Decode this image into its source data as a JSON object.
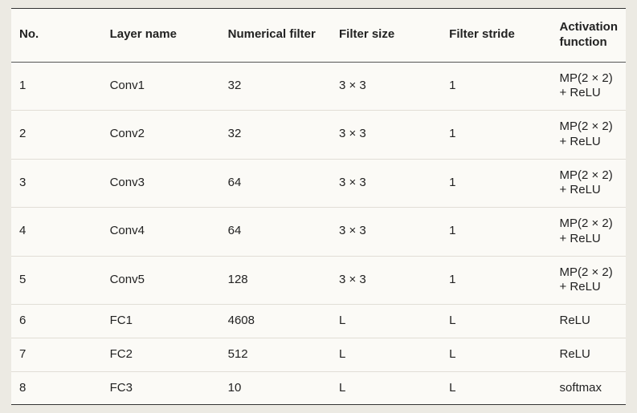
{
  "chart_data": {
    "type": "table",
    "headers": [
      "No.",
      "Layer name",
      "Numerical filter",
      "Filter size",
      "Filter stride",
      "Activation function"
    ],
    "rows": [
      {
        "no": "1",
        "layer": "Conv1",
        "numf": "32",
        "fsize": "3 × 3",
        "stride": "1",
        "act": "MP(2 × 2) + ReLU"
      },
      {
        "no": "2",
        "layer": "Conv2",
        "numf": "32",
        "fsize": "3 × 3",
        "stride": "1",
        "act": "MP(2 × 2) + ReLU"
      },
      {
        "no": "3",
        "layer": "Conv3",
        "numf": "64",
        "fsize": "3 × 3",
        "stride": "1",
        "act": "MP(2 × 2) + ReLU"
      },
      {
        "no": "4",
        "layer": "Conv4",
        "numf": "64",
        "fsize": "3 × 3",
        "stride": "1",
        "act": "MP(2 × 2) + ReLU"
      },
      {
        "no": "5",
        "layer": "Conv5",
        "numf": "128",
        "fsize": "3 × 3",
        "stride": "1",
        "act": "MP(2 × 2) + ReLU"
      },
      {
        "no": "6",
        "layer": "FC1",
        "numf": "4608",
        "fsize": "L",
        "stride": "L",
        "act": "ReLU"
      },
      {
        "no": "7",
        "layer": "FC2",
        "numf": "512",
        "fsize": "L",
        "stride": "L",
        "act": "ReLU"
      },
      {
        "no": "8",
        "layer": "FC3",
        "numf": "10",
        "fsize": "L",
        "stride": "L",
        "act": "softmax"
      }
    ]
  }
}
